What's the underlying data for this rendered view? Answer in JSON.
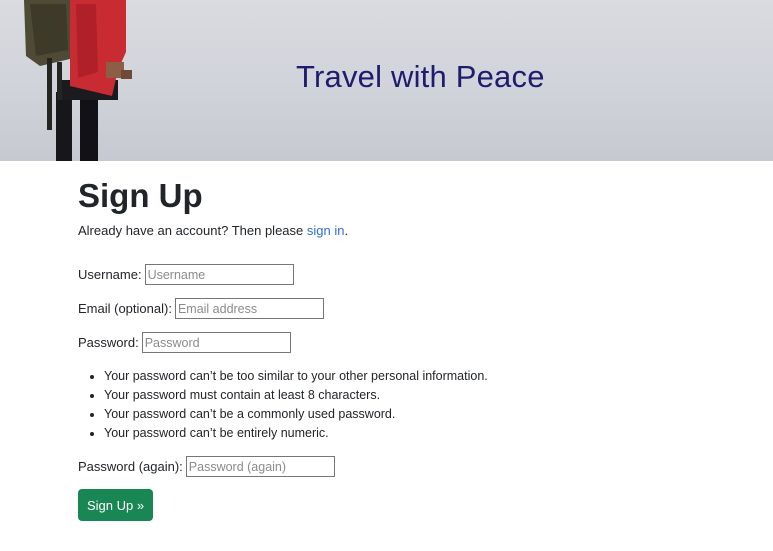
{
  "header": {
    "title": "Travel with Peace"
  },
  "page": {
    "title": "Sign Up",
    "intro_text": "Already have an account? Then please ",
    "intro_link": "sign in",
    "intro_end": "."
  },
  "form": {
    "username": {
      "label": "Username:",
      "placeholder": "Username",
      "value": ""
    },
    "email": {
      "label": "Email (optional):",
      "placeholder": "Email address",
      "value": ""
    },
    "password1": {
      "label": "Password:",
      "placeholder": "Password",
      "value": ""
    },
    "password_help": [
      "Your password can’t be too similar to your other personal information.",
      "Your password must contain at least 8 characters.",
      "Your password can’t be a commonly used password.",
      "Your password can’t be entirely numeric."
    ],
    "password2": {
      "label": "Password (again):",
      "placeholder": "Password (again)",
      "value": ""
    },
    "submit_label": "Sign Up »"
  },
  "colors": {
    "header_title": "#1f1b6e",
    "link": "#2f6fd6",
    "submit_button": "#198754"
  }
}
